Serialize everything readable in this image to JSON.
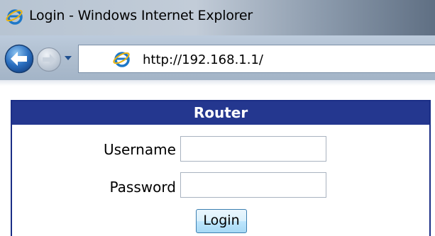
{
  "window": {
    "title": "Login - Windows Internet Explorer",
    "icon": "internet-explorer-icon"
  },
  "navigation": {
    "back_icon": "back-arrow-icon",
    "forward_icon": "forward-arrow-icon",
    "history_icon": "chevron-down-icon",
    "address_url": "http://192.168.1.1/",
    "address_icon": "internet-explorer-icon"
  },
  "login_panel": {
    "title": "Router",
    "username_label": "Username :",
    "username_value": "",
    "password_label": "Password :",
    "password_value": "",
    "login_button": "Login"
  },
  "colors": {
    "panel_header": "#24378f",
    "panel_border": "#1b2e86",
    "button_border": "#3c7fb1"
  }
}
